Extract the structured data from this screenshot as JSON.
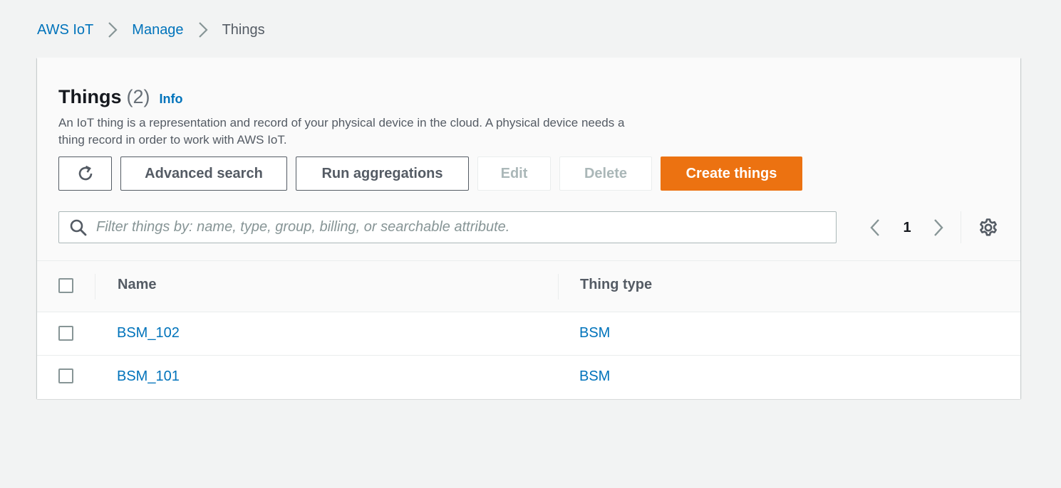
{
  "breadcrumb": {
    "items": [
      "AWS IoT",
      "Manage",
      "Things"
    ]
  },
  "header": {
    "title": "Things",
    "count": "(2)",
    "info_label": "Info",
    "description": "An IoT thing is a representation and record of your physical device in the cloud. A physical device needs a thing record in order to work with AWS IoT."
  },
  "toolbar": {
    "refresh_icon": "refresh-icon",
    "advanced_search_label": "Advanced search",
    "run_aggregations_label": "Run aggregations",
    "edit_label": "Edit",
    "delete_label": "Delete",
    "create_label": "Create things"
  },
  "filter": {
    "placeholder": "Filter things by: name, type, group, billing, or searchable attribute.",
    "value": ""
  },
  "pagination": {
    "current_page": "1"
  },
  "table": {
    "columns": [
      "Name",
      "Thing type"
    ],
    "rows": [
      {
        "name": "BSM_102",
        "thing_type": "BSM"
      },
      {
        "name": "BSM_101",
        "thing_type": "BSM"
      }
    ]
  },
  "colors": {
    "link": "#0073bb",
    "primary": "#ec7211",
    "background": "#f2f3f3"
  }
}
